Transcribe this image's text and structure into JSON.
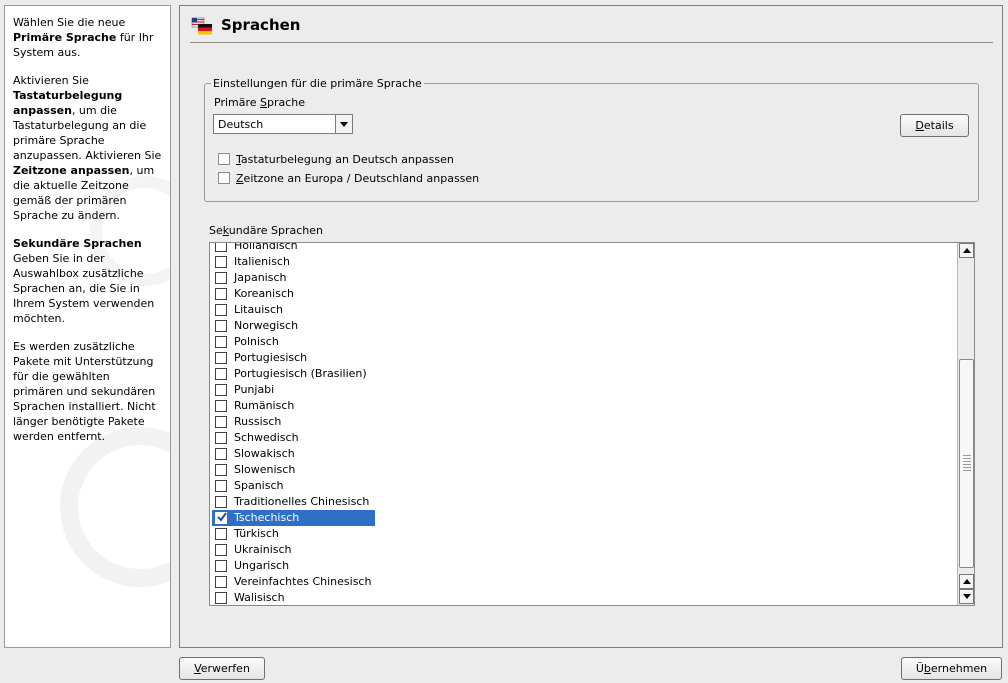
{
  "help": {
    "p1_pre": "Wählen Sie die neue ",
    "p1_bold": "Primäre Sprache",
    "p1_post": " für Ihr System aus.",
    "p2_pre": "Aktivieren Sie ",
    "p2_bold1": "Tastaturbelegung anpassen",
    "p2_mid": ", um die Tastaturbelegung an die primäre Sprache anzupassen. Aktivieren Sie ",
    "p2_bold2": "Zeitzone anpassen",
    "p2_post": ", um die aktuelle Zeitzone gemäß der primären Sprache zu ändern.",
    "p3_bold": "Sekundäre Sprachen",
    "p3_post": " Geben Sie in der Auswahlbox zusätzliche Sprachen an, die Sie in Ihrem System verwenden möchten.",
    "p4": "Es werden zusätzliche Pakete mit Unterstützung für die gewählten primären und sekundären Sprachen installiert. Nicht länger benötigte Pakete werden entfernt."
  },
  "header": {
    "title": "Sprachen"
  },
  "primary": {
    "group_label": "Einstellungen für die primäre Sprache",
    "field_label_pre": "Primäre ",
    "field_label_accel": "S",
    "field_label_post": "prache",
    "selected": "Deutsch",
    "details_accel": "D",
    "details_rest": "etails",
    "keyboard_accel": "T",
    "keyboard_rest": "astaturbelegung an Deutsch anpassen",
    "keyboard_checked": false,
    "timezone_accel": "Z",
    "timezone_rest": "eitzone an Europa / Deutschland anpassen",
    "timezone_checked": false
  },
  "secondary": {
    "label_pre": "Se",
    "label_accel": "k",
    "label_post": "undäre Sprachen",
    "items": [
      {
        "name": "Holländisch",
        "checked": false,
        "selected": false
      },
      {
        "name": "Italienisch",
        "checked": false,
        "selected": false
      },
      {
        "name": "Japanisch",
        "checked": false,
        "selected": false
      },
      {
        "name": "Koreanisch",
        "checked": false,
        "selected": false
      },
      {
        "name": "Litauisch",
        "checked": false,
        "selected": false
      },
      {
        "name": "Norwegisch",
        "checked": false,
        "selected": false
      },
      {
        "name": "Polnisch",
        "checked": false,
        "selected": false
      },
      {
        "name": "Portugiesisch",
        "checked": false,
        "selected": false
      },
      {
        "name": "Portugiesisch (Brasilien)",
        "checked": false,
        "selected": false
      },
      {
        "name": "Punjabi",
        "checked": false,
        "selected": false
      },
      {
        "name": "Rumänisch",
        "checked": false,
        "selected": false
      },
      {
        "name": "Russisch",
        "checked": false,
        "selected": false
      },
      {
        "name": "Schwedisch",
        "checked": false,
        "selected": false
      },
      {
        "name": "Slowakisch",
        "checked": false,
        "selected": false
      },
      {
        "name": "Slowenisch",
        "checked": false,
        "selected": false
      },
      {
        "name": "Spanisch",
        "checked": false,
        "selected": false
      },
      {
        "name": "Traditionelles Chinesisch",
        "checked": false,
        "selected": false
      },
      {
        "name": "Tschechisch",
        "checked": true,
        "selected": true
      },
      {
        "name": "Türkisch",
        "checked": false,
        "selected": false
      },
      {
        "name": "Ukrainisch",
        "checked": false,
        "selected": false
      },
      {
        "name": "Ungarisch",
        "checked": false,
        "selected": false
      },
      {
        "name": "Vereinfachtes Chinesisch",
        "checked": false,
        "selected": false
      },
      {
        "name": "Walisisch",
        "checked": false,
        "selected": false
      }
    ]
  },
  "footer": {
    "discard_accel": "V",
    "discard_rest": "erwerfen",
    "accept_pre": "Ü",
    "accept_accel": "b",
    "accept_rest": "ernehmen"
  },
  "colors": {
    "selection": "#2f70c7",
    "panel": "#ececec"
  },
  "icons": {
    "title": "flag-icon"
  }
}
